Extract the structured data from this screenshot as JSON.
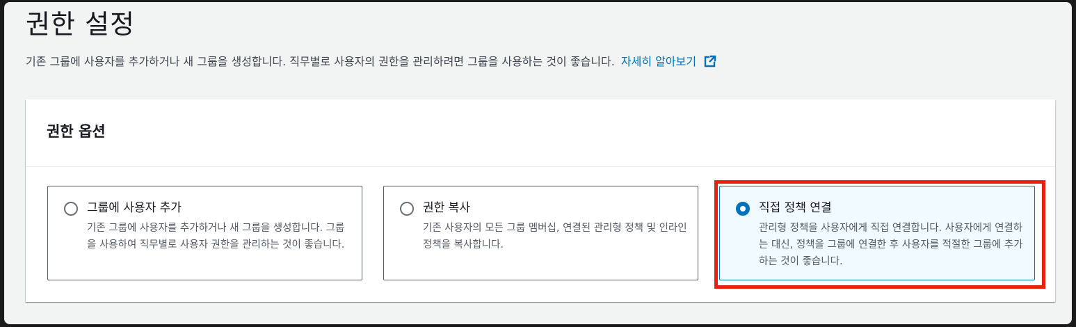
{
  "page": {
    "title": "권한 설정",
    "description": "기존 그룹에 사용자를 추가하거나 새 그룹을 생성합니다. 직무별로 사용자의 권한을 관리하려면 그룹을 사용하는 것이 좋습니다.",
    "learn_more_label": "자세히 알아보기",
    "learn_more_icon": "external-link-icon"
  },
  "permissions_panel": {
    "title": "권한 옵션",
    "options": [
      {
        "label": "그룹에 사용자 추가",
        "description": "기존 그룹에 사용자를 추가하거나 새 그룹을 생성합니다. 그룹을 사용하여 직무별로 사용자 권한을 관리하는 것이 좋습니다.",
        "selected": false
      },
      {
        "label": "권한 복사",
        "description": "기존 사용자의 모든 그룹 멤버십, 연결된 관리형 정책 및 인라인 정책을 복사합니다.",
        "selected": false
      },
      {
        "label": "직접 정책 연결",
        "description": "관리형 정책을 사용자에게 직접 연결합니다. 사용자에게 연결하는 대신, 정책을 그룹에 연결한 후 사용자를 적절한 그룹에 추가하는 것이 좋습니다.",
        "selected": true
      }
    ]
  },
  "colors": {
    "link": "#0073bb",
    "selected_border": "#0073bb",
    "selected_background": "#f1faff",
    "highlight": "#e8210c"
  }
}
